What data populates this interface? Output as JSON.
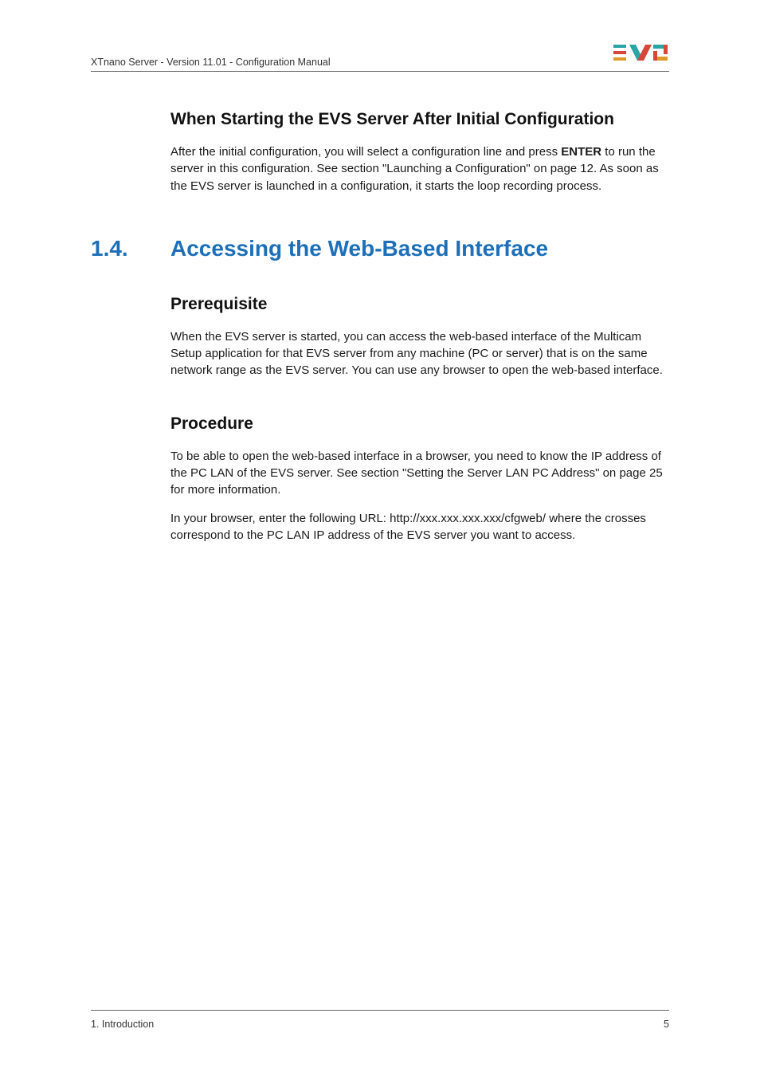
{
  "header": {
    "text": "XTnano Server - Version 11.01 - Configuration Manual"
  },
  "section1": {
    "heading": "When Starting the EVS Server After Initial Configuration",
    "para_before_bold": "After the initial configuration, you will select a configuration line and press ",
    "bold_word": "ENTER",
    "para_after_bold": " to run the server in this configuration. See section \"Launching a Configuration\" on page 12. As soon as the EVS server is launched in a configuration, it starts the loop recording process."
  },
  "main_section": {
    "number": "1.4.",
    "title": "Accessing the Web-Based Interface"
  },
  "prereq": {
    "heading": "Prerequisite",
    "para": "When the EVS server is started, you can access the web-based interface of the Multicam Setup application for that EVS server from any machine (PC or server) that is on the same network range as the EVS server. You can use any browser to open the web-based interface."
  },
  "procedure": {
    "heading": "Procedure",
    "para1": "To be able to open the web-based interface in a browser, you need to know the IP address of the PC LAN of the EVS server. See section \"Setting the Server LAN PC Address\" on page 25 for more information.",
    "para2": "In your browser, enter the following URL: http://xxx.xxx.xxx.xxx/cfgweb/ where the crosses correspond to the PC LAN IP address of the EVS server you want to access."
  },
  "footer": {
    "left": "1. Introduction",
    "right": "5"
  }
}
